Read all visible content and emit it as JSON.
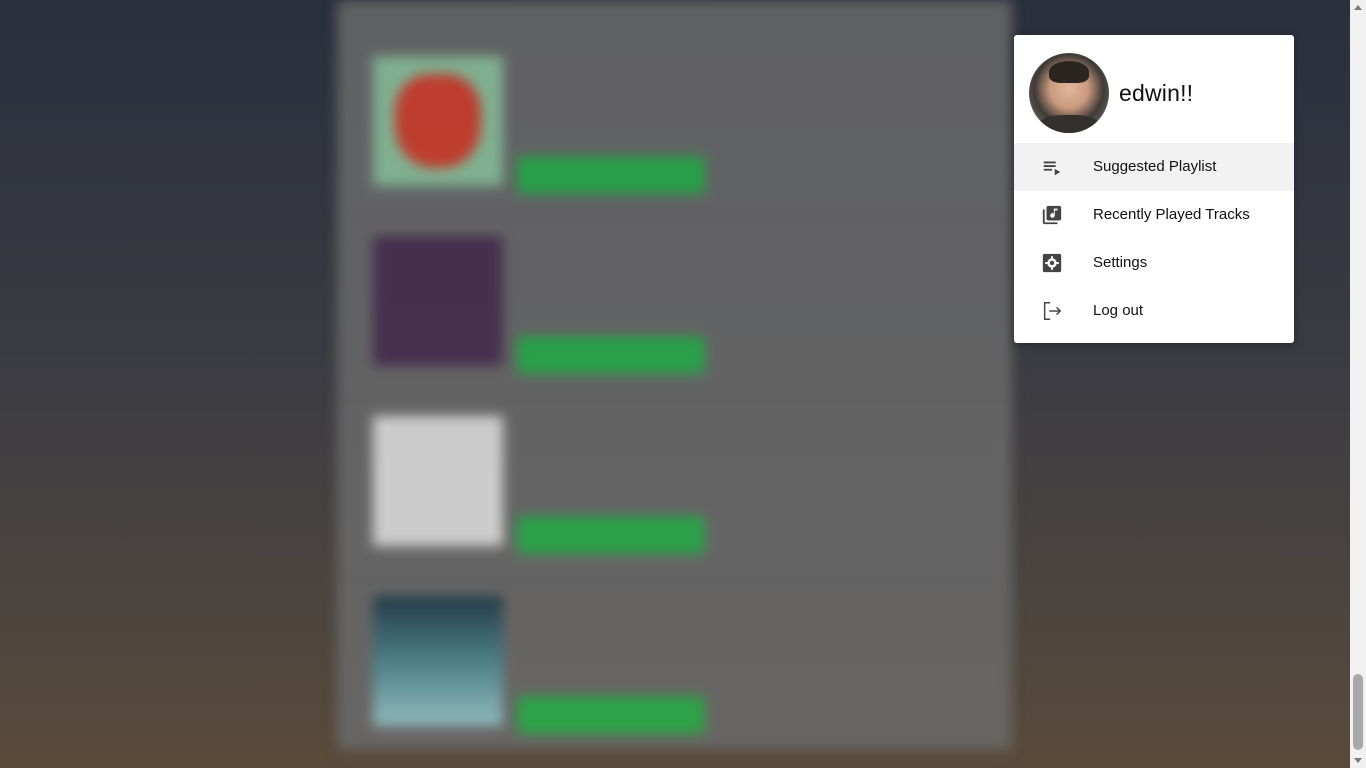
{
  "menu": {
    "username": "edwin!!",
    "items": [
      {
        "label": "Suggested Playlist",
        "icon": "playlist-play-icon"
      },
      {
        "label": "Recently Played Tracks",
        "icon": "library-music-icon"
      },
      {
        "label": "Settings",
        "icon": "settings-cog-icon"
      },
      {
        "label": "Log out",
        "icon": "logout-icon"
      }
    ]
  },
  "colors": {
    "play_button": "#27b34b",
    "menu_bg": "#ffffff",
    "active_item_bg": "#f2f2f2"
  }
}
